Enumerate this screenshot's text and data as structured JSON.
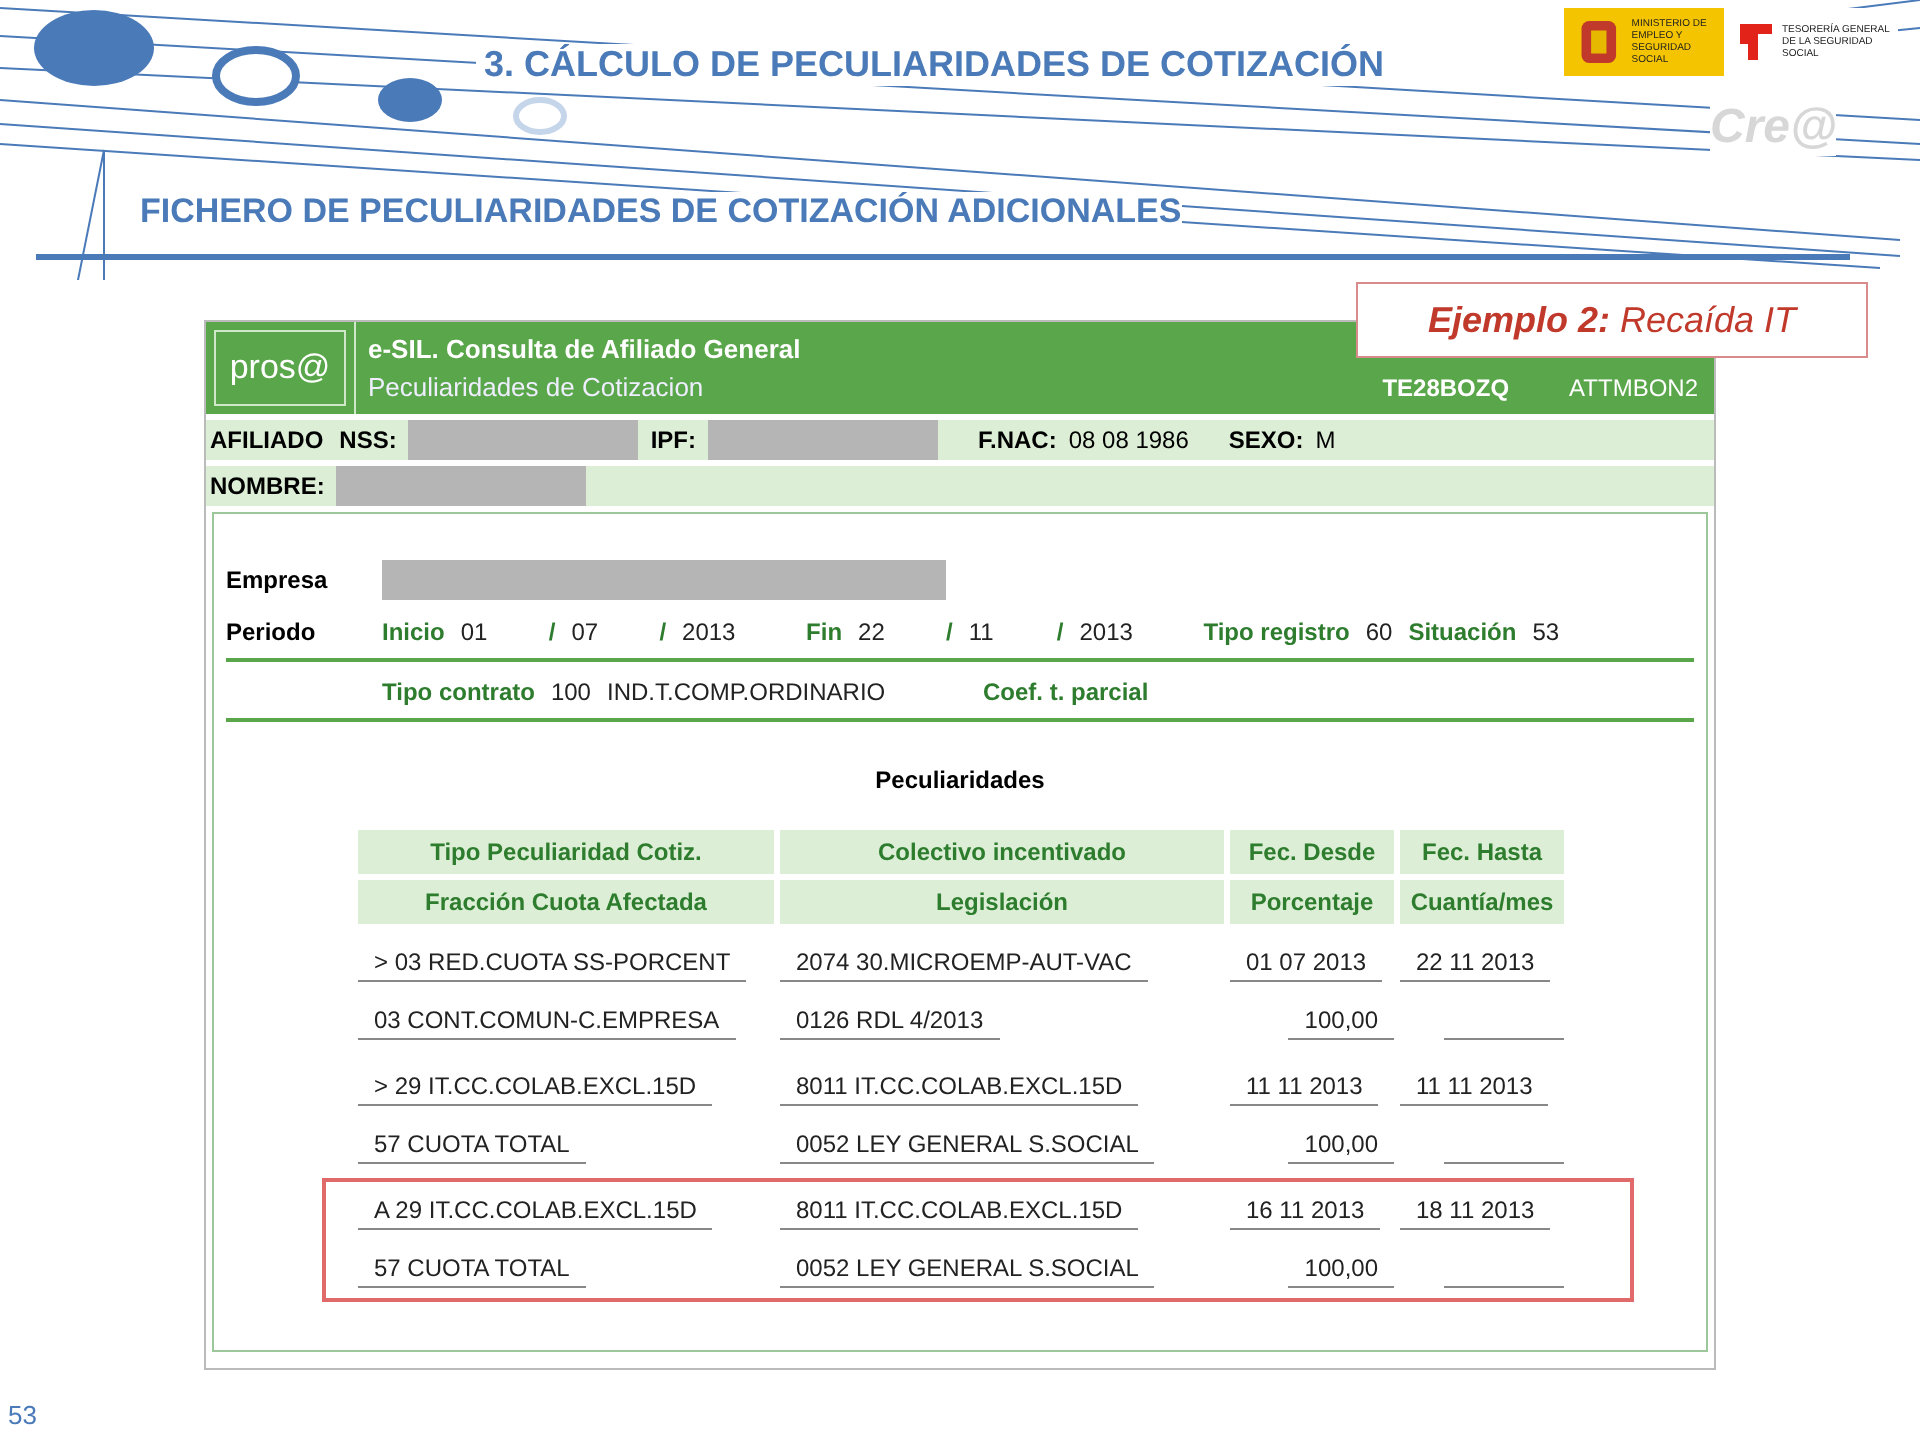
{
  "slide": {
    "section_title": "3.  CÁLCULO DE PECULIARIDADES DE COTIZACIÓN",
    "subtitle": "FICHERO DE PECULIARIDADES DE COTIZACIÓN ADICIONALES",
    "callout": "**Ejemplo 2:** Recaída IT",
    "page_number": "53"
  },
  "logos": {
    "ministry": "MINISTERIO DE EMPLEO Y SEGURIDAD SOCIAL",
    "tesoreria": "TESORERÍA GENERAL DE LA SEGURIDAD SOCIAL",
    "brand": "Cre@"
  },
  "app": {
    "logo": "pros@",
    "title": "e-SIL. Consulta de Afiliado General",
    "subtitle": "Peculiaridades de Cotizacion",
    "terminal": "TE28BOZQ",
    "user": "ATTMBON2"
  },
  "afiliado": {
    "label": "AFILIADO",
    "fields": [
      {
        "label": "NSS:",
        "kind": "redacted"
      },
      {
        "label": "IPF:",
        "kind": "redacted"
      },
      {
        "label": "F.NAC:",
        "kind": "value",
        "value": "08  08  1986"
      },
      {
        "label": "SEXO:",
        "kind": "value",
        "value": "M"
      }
    ],
    "nombre_label": "NOMBRE:"
  },
  "empresa_label": "Empresa",
  "periodo": {
    "label": "Periodo",
    "inicio_label": "Inicio",
    "inicio": [
      "01",
      "07",
      "2013"
    ],
    "fin_label": "Fin",
    "fin": [
      "22",
      "11",
      "2013"
    ],
    "separator": "/",
    "tipo_registro_label": "Tipo registro",
    "tipo_registro": "60",
    "situacion_label": "Situación",
    "situacion": "53"
  },
  "contrato": {
    "label": "Tipo contrato",
    "code": "100",
    "value": "IND.T.COMP.ORDINARIO",
    "coef_label": "Coef. t. parcial"
  },
  "table": {
    "title": "Peculiaridades",
    "header_rows": [
      [
        "Tipo Peculiaridad Cotiz.",
        "Colectivo incentivado",
        "Fec. Desde",
        "Fec. Hasta"
      ],
      [
        "Fracción Cuota Afectada",
        "Legislación",
        "Porcentaje",
        "Cuantía/mes"
      ]
    ],
    "groups": [
      {
        "highlighted": false,
        "rows": [
          [
            "> 03 RED.CUOTA SS-PORCENT",
            "2074 30.MICROEMP-AUT-VAC",
            "01 07 2013",
            "22 11 2013"
          ],
          [
            "03 CONT.COMUN-C.EMPRESA",
            "0126 RDL 4/2013",
            "100,00",
            null
          ]
        ]
      },
      {
        "highlighted": false,
        "rows": [
          [
            "> 29 IT.CC.COLAB.EXCL.15D",
            "8011 IT.CC.COLAB.EXCL.15D",
            "11 11 2013",
            "11 11 2013"
          ],
          [
            "57 CUOTA TOTAL",
            "0052 LEY GENERAL S.SOCIAL",
            "100,00",
            null
          ]
        ]
      },
      {
        "highlighted": true,
        "rows": [
          [
            "A 29 IT.CC.COLAB.EXCL.15D",
            "8011 IT.CC.COLAB.EXCL.15D",
            "16 11 2013",
            "18 11 2013"
          ],
          [
            "57 CUOTA TOTAL",
            "0052 LEY GENERAL S.SOCIAL",
            "100,00",
            null
          ]
        ]
      }
    ]
  }
}
